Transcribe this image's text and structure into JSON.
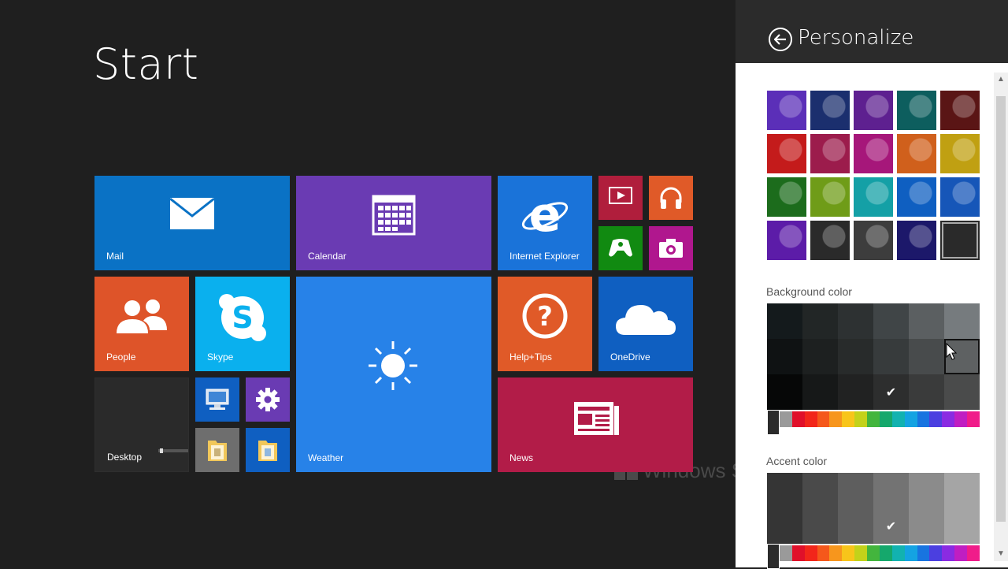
{
  "start": {
    "title": "Start",
    "watermark": "Windows S"
  },
  "tiles": [
    {
      "id": "mail",
      "label": "Mail",
      "color": "#0a72c5",
      "icon": "mail-icon"
    },
    {
      "id": "calendar",
      "label": "Calendar",
      "color": "#6a3bb3",
      "icon": "calendar-icon"
    },
    {
      "id": "ie",
      "label": "Internet Explorer",
      "color": "#1a73d9",
      "icon": "internet-explorer-icon"
    },
    {
      "id": "video",
      "label": "",
      "color": "#b01e3c",
      "icon": "video-icon"
    },
    {
      "id": "music",
      "label": "",
      "color": "#e05a28",
      "icon": "headphones-icon"
    },
    {
      "id": "games",
      "label": "",
      "color": "#118a11",
      "icon": "xbox-controller-icon"
    },
    {
      "id": "camera",
      "label": "",
      "color": "#b0178e",
      "icon": "camera-icon"
    },
    {
      "id": "people",
      "label": "People",
      "color": "#de5429",
      "icon": "people-icon"
    },
    {
      "id": "skype",
      "label": "Skype",
      "color": "#0ab0ee",
      "icon": "skype-icon"
    },
    {
      "id": "weather",
      "label": "Weather",
      "color": "#2782e8",
      "icon": "sun-icon"
    },
    {
      "id": "helptips",
      "label": "Help+Tips",
      "color": "#e05a28",
      "icon": "question-icon"
    },
    {
      "id": "onedrive",
      "label": "OneDrive",
      "color": "#0f5fc1",
      "icon": "cloud-icon"
    },
    {
      "id": "desktop",
      "label": "Desktop",
      "color": "#2a2a2a",
      "icon": "desktop-wallpaper-icon"
    },
    {
      "id": "pc",
      "label": "",
      "color": "#0f5fc1",
      "icon": "computer-icon"
    },
    {
      "id": "settings",
      "label": "",
      "color": "#6a3bb3",
      "icon": "gear-icon"
    },
    {
      "id": "explorer1",
      "label": "",
      "color": "#6e6e6e",
      "icon": "folder-icon"
    },
    {
      "id": "explorer2",
      "label": "",
      "color": "#0f5fc1",
      "icon": "folder-icon"
    },
    {
      "id": "news",
      "label": "News",
      "color": "#b21c48",
      "icon": "newspaper-icon"
    }
  ],
  "personalize": {
    "title": "Personalize",
    "background_color_label": "Background color",
    "accent_color_label": "Accent color",
    "selected_check": "✔",
    "patterns": [
      "#5b2fb8",
      "#1b2f6e",
      "#5e2090",
      "#0d5e5e",
      "#5a1515",
      "#c41b1b",
      "#9c1c4c",
      "#a6177a",
      "#d0601c",
      "#c0a012",
      "#1c6c1c",
      "#6f9c18",
      "#14a0a6",
      "#0f5fc1",
      "#1656b8",
      "#5c1ca8",
      "#2a2a2a",
      "#3d3d3d",
      "#1c186a",
      "#2a2a2a"
    ],
    "background_swatches": [
      "#141a1c",
      "#222626",
      "#2d3132",
      "#404547",
      "#5b5f61",
      "#767b7e",
      "#0f1213",
      "#1d2020",
      "#282b2b",
      "#373b3c",
      "#484b4c",
      "#5e6162",
      "#060707",
      "#161818",
      "#212222",
      "#2d2e2e",
      "#3a3b3b",
      "#4a4b4b"
    ],
    "background_selected_index": 15,
    "background_hover_index": 11,
    "accent_swatches": [
      "#353535",
      "#4a4a4a",
      "#5e5e5e",
      "#737373",
      "#8b8b8b",
      "#a5a5a5",
      "#353535",
      "#4a4a4a",
      "#5e5e5e",
      "#737373",
      "#8b8b8b",
      "#a5a5a5"
    ],
    "accent_selected_index": 9,
    "hue_colors": [
      "#3a3a3a",
      "#9a9a9a",
      "#e0102a",
      "#f2261a",
      "#f5581b",
      "#f7961d",
      "#f8c51a",
      "#c3d21a",
      "#43b53d",
      "#15a86c",
      "#12b2b0",
      "#14a3e2",
      "#1874e0",
      "#4b3fe0",
      "#8a2be2",
      "#c01ec2",
      "#f01c8a"
    ]
  }
}
